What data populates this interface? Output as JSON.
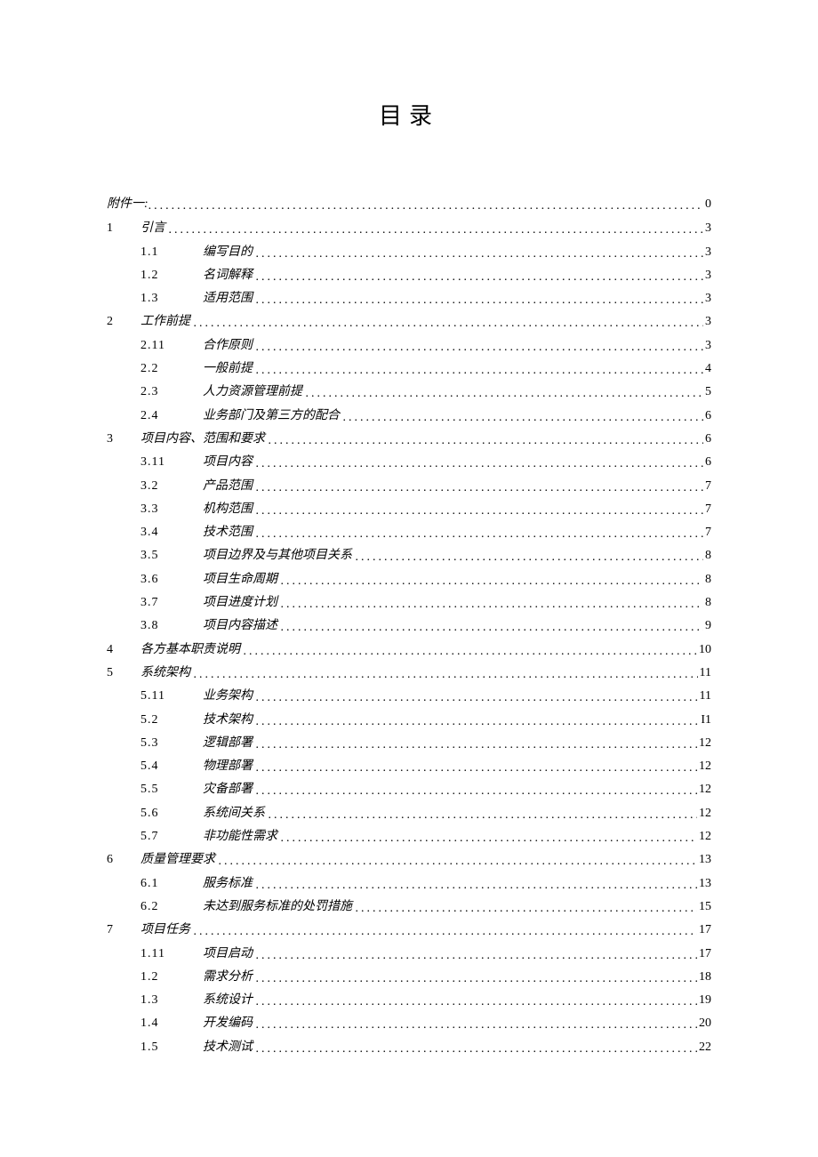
{
  "title": "目录",
  "entries": [
    {
      "type": "attach",
      "label": "附件一:",
      "page": "0"
    },
    {
      "type": "chapter",
      "num": "1",
      "label": "引言",
      "page": "3"
    },
    {
      "type": "sub",
      "sub": "1.1",
      "label": "编写目的",
      "page": "3"
    },
    {
      "type": "sub",
      "sub": "1.2",
      "label": "名词解释",
      "page": "3"
    },
    {
      "type": "sub",
      "sub": "1.3",
      "label": "适用范围",
      "page": "3"
    },
    {
      "type": "chapter",
      "num": "2",
      "label": "工作前提",
      "page": "3"
    },
    {
      "type": "sub",
      "sub": "2.11",
      "label": "合作原则",
      "page": "3"
    },
    {
      "type": "sub",
      "sub": "2.2",
      "label": "一般前提",
      "page": "4"
    },
    {
      "type": "sub",
      "sub": "2.3",
      "label": "人力资源管理前提",
      "page": "5"
    },
    {
      "type": "sub",
      "sub": "2.4",
      "label": "业务部门及第三方的配合",
      "page": "6"
    },
    {
      "type": "chapter",
      "num": "3",
      "label": "项目内容、范围和要求",
      "page": "6"
    },
    {
      "type": "sub",
      "sub": "3.11",
      "label": "项目内容",
      "page": "6"
    },
    {
      "type": "sub",
      "sub": "3.2",
      "label": "产品范围",
      "page": "7"
    },
    {
      "type": "sub",
      "sub": "3.3",
      "label": "机构范围",
      "page": "7"
    },
    {
      "type": "sub",
      "sub": "3.4",
      "label": "技术范围",
      "page": "7"
    },
    {
      "type": "sub",
      "sub": "3.5",
      "label": "项目边界及与其他项目关系",
      "page": "8"
    },
    {
      "type": "sub",
      "sub": "3.6",
      "label": "项目生命周期",
      "page": "8"
    },
    {
      "type": "sub",
      "sub": "3.7",
      "label": "项目进度计划",
      "page": "8"
    },
    {
      "type": "sub",
      "sub": "3.8",
      "label": "项目内容描述",
      "page": "9"
    },
    {
      "type": "chapter",
      "num": "4",
      "label": "各方基本职责说明",
      "page": "10"
    },
    {
      "type": "chapter",
      "num": "5",
      "label": "系统架构",
      "page": "11"
    },
    {
      "type": "sub",
      "sub": "5.11",
      "label": "业务架构",
      "page": "11"
    },
    {
      "type": "sub",
      "sub": "5.2",
      "label": "技术架构",
      "page": "I1"
    },
    {
      "type": "sub",
      "sub": "5.3",
      "label": "逻辑部署",
      "page": "12"
    },
    {
      "type": "sub",
      "sub": "5.4",
      "label": "物理部署",
      "page": "12"
    },
    {
      "type": "sub",
      "sub": "5.5",
      "label": "灾备部署",
      "page": "12"
    },
    {
      "type": "sub",
      "sub": "5.6",
      "label": "系统间关系",
      "page": "12"
    },
    {
      "type": "sub",
      "sub": "5.7",
      "label": "非功能性需求",
      "page": "12"
    },
    {
      "type": "chapter",
      "num": "6",
      "label": "质量管理要求",
      "page": "13"
    },
    {
      "type": "sub",
      "sub": "6.1",
      "label": "服务标准",
      "page": "13"
    },
    {
      "type": "sub",
      "sub": "6.2",
      "label": "未达到服务标准的处罚措施",
      "page": "15"
    },
    {
      "type": "chapter",
      "num": "7",
      "label": "项目任务",
      "page": "17"
    },
    {
      "type": "sub",
      "sub": "1.11",
      "label": "项目启动",
      "page": "17"
    },
    {
      "type": "sub",
      "sub": "1.2",
      "label": "需求分析",
      "page": "18"
    },
    {
      "type": "sub",
      "sub": "1.3",
      "label": "系统设计",
      "page": "19"
    },
    {
      "type": "sub",
      "sub": "1.4",
      "label": "开发编码",
      "page": "20"
    },
    {
      "type": "sub",
      "sub": "1.5",
      "label": "技术测试",
      "page": "22"
    }
  ]
}
